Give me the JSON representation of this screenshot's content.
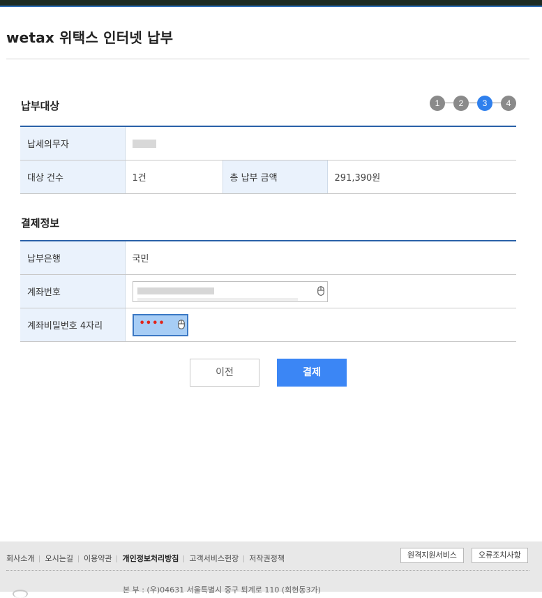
{
  "header": {
    "title": "wetax 위택스 인터넷 납부"
  },
  "payment_target": {
    "section_title": "납부대상",
    "steps": [
      "1",
      "2",
      "3",
      "4"
    ],
    "active_step": 3,
    "taxpayer_label": "납세의무자",
    "count_label": "대상 건수",
    "count_value": "1건",
    "total_label": "총 납부 금액",
    "total_value": "291,390원"
  },
  "payment_info": {
    "section_title": "결제정보",
    "bank_label": "납부은행",
    "bank_value": "국민",
    "account_label": "계좌번호",
    "password_label": "계좌비밀번호 4자리",
    "password_mask": "••••"
  },
  "buttons": {
    "prev": "이전",
    "pay": "결제"
  },
  "footer": {
    "links": [
      "회사소개",
      "오시는길",
      "이용약관",
      "개인정보처리방침",
      "고객서비스헌장",
      "저작권정책"
    ],
    "remote_support": "원격지원서비스",
    "error_fix": "오류조치사항",
    "address": "본 부 : (우)04631 서울특별시 중구 퇴계로 110 (회현동3가)"
  },
  "colors": {
    "accent": "#3b86f5",
    "table_border": "#2a61a8",
    "active_step": "#2f80ed"
  }
}
